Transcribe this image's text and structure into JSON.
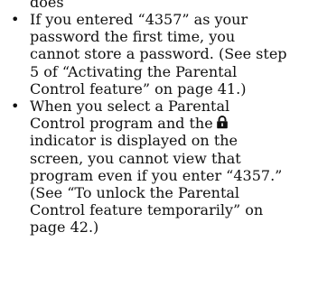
{
  "doc": {
    "cut_line": "does",
    "notes": [
      {
        "lines": [
          "password the first time, you",
          "cannot store a password. (See step",
          "5 of “Activating the Parental",
          "Control feature” on page 41.)"
        ],
        "first_line": "If you entered “4357” as your"
      },
      {
        "first_line": "When you select a Parental",
        "line2_before_icon": "Control program and the",
        "line2_after_icon": "",
        "lines": [
          "indicator is displayed on the",
          "screen, you cannot view that",
          "program even if you enter “4357.”",
          "(See “To unlock the Parental",
          "Control feature temporarily” on",
          "page 42.)"
        ]
      }
    ],
    "bullet_char": "•",
    "lock_icon": "lock-icon"
  }
}
